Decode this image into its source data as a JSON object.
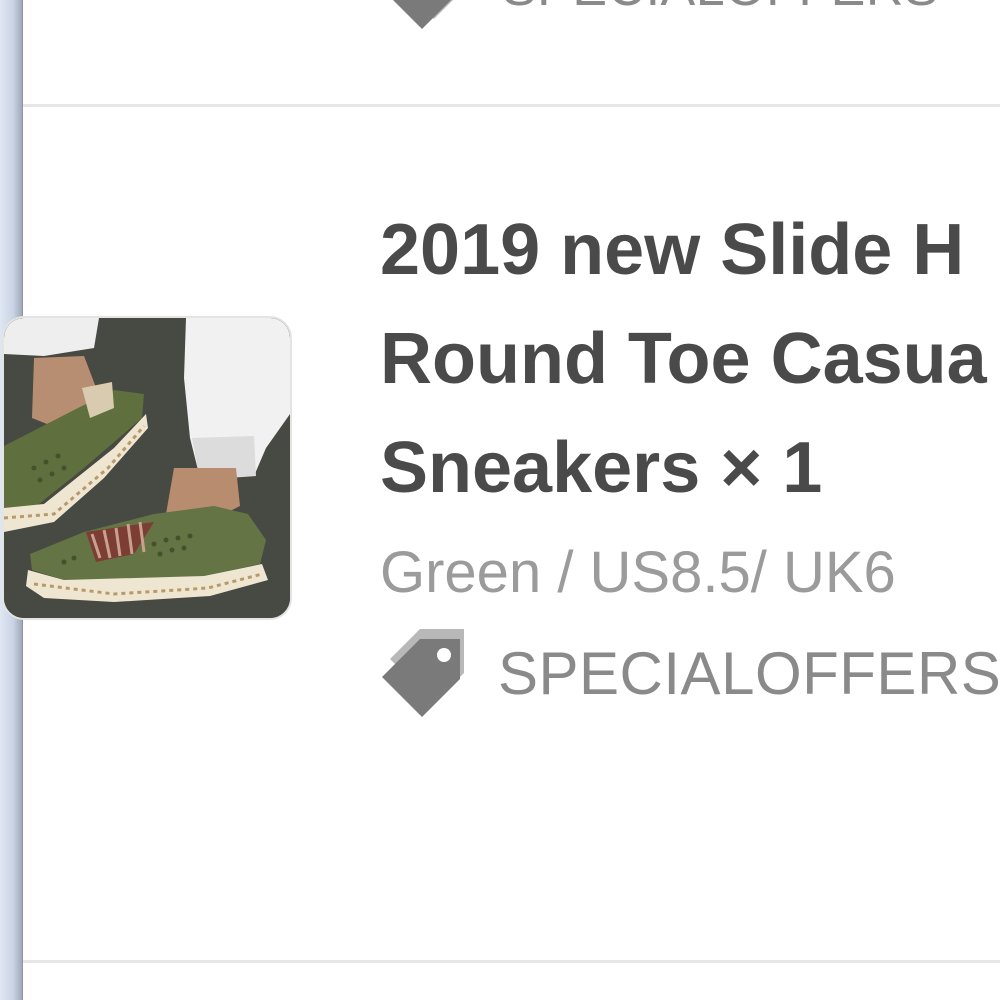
{
  "previous_item": {
    "promo_code": "SPECIALOFFERS",
    "icon": "tag-icon"
  },
  "item": {
    "title_line1": "2019 new Slide H",
    "title_line2": "Round Toe Casua",
    "title_line3": "Sneakers × 1",
    "variant": "Green / US8.5/ UK6",
    "promo_code": "SPECIALOFFERS",
    "promo_icon": "tag-icon",
    "image_alt": "green perforated slip-on sneakers"
  },
  "colors": {
    "title": "#4a4a4a",
    "secondary_text": "#9b9b9b",
    "tag_icon": "#7a7a7a",
    "divider": "#e6e6e6"
  }
}
